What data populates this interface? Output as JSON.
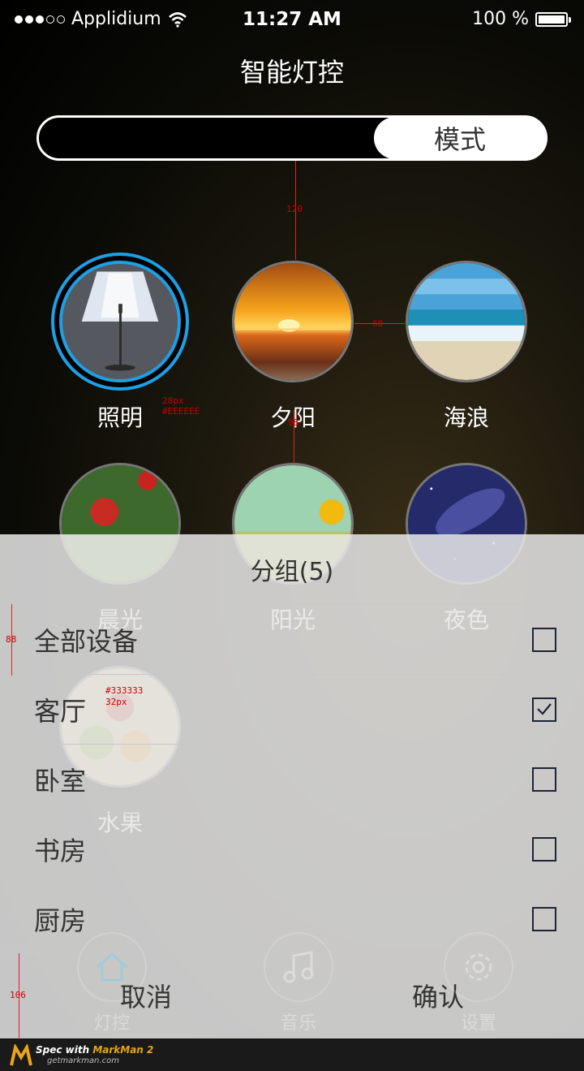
{
  "status": {
    "carrier": "Applidium",
    "time": "11:27 AM",
    "battery": "100 %"
  },
  "header": {
    "title": "智能灯控"
  },
  "segment": {
    "active_label": "模式"
  },
  "modes": [
    {
      "label": "照明",
      "icon": "lamp-icon",
      "selected": true
    },
    {
      "label": "夕阳",
      "icon": "sunset-image"
    },
    {
      "label": "海浪",
      "icon": "beach-image"
    },
    {
      "label": "晨光",
      "icon": "roses-image"
    },
    {
      "label": "阳光",
      "icon": "sunflower-image"
    },
    {
      "label": "夜色",
      "icon": "starry-sky-image"
    },
    {
      "label": "水果",
      "icon": "fruit-image"
    }
  ],
  "annotations": {
    "gap_top": "120",
    "gap_h": "60",
    "gap_v": "98",
    "label_size": "28px",
    "label_color": "#EEEEEE",
    "row_color": "#333333",
    "row_size": "32px",
    "row_height": "88",
    "button_height": "106"
  },
  "sheet": {
    "title": "分组(5)",
    "groups": [
      {
        "label": "全部设备",
        "checked": false
      },
      {
        "label": "客厅",
        "checked": true
      },
      {
        "label": "卧室",
        "checked": false
      },
      {
        "label": "书房",
        "checked": false
      },
      {
        "label": "厨房",
        "checked": false
      }
    ],
    "cancel_label": "取消",
    "confirm_label": "确认"
  },
  "tabbar": {
    "items": [
      {
        "label": "灯控",
        "icon": "home-icon"
      },
      {
        "label": "音乐",
        "icon": "music-icon"
      },
      {
        "label": "设置",
        "icon": "gear-icon"
      }
    ]
  },
  "footer": {
    "brand_prefix": "Spec with",
    "brand": "MarkMan 2",
    "url": "getmarkman.com"
  },
  "colors": {
    "accent": "#1da0e6",
    "text_dark": "#333333",
    "label_light": "#EEEEEE",
    "annotation": "#d22222"
  }
}
